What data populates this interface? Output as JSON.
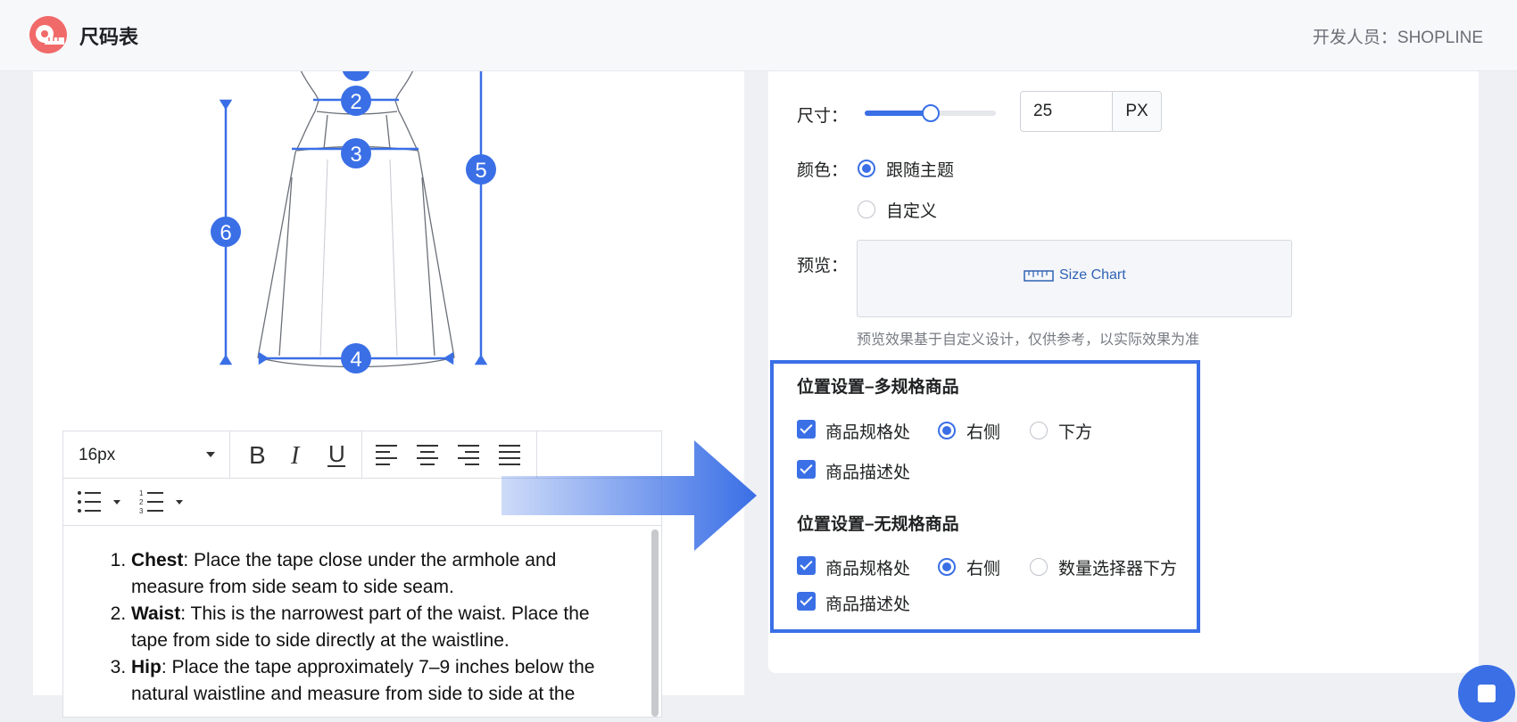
{
  "header": {
    "app_title": "尺码表",
    "developer": "开发人员：SHOPLINE"
  },
  "illustration": {
    "markers": [
      "2",
      "3",
      "4",
      "5",
      "6"
    ]
  },
  "editor": {
    "font_size": "16px",
    "items": [
      {
        "term": "Chest",
        "text": ": Place the tape close under the armhole and measure from side seam to side seam."
      },
      {
        "term": "Waist",
        "text": ": This is the narrowest part of the waist. Place the tape from side to side directly at the waistline."
      },
      {
        "term": "Hip",
        "text": ": Place the tape approximately 7–9 inches below the natural waistline and measure from side to side at the"
      }
    ]
  },
  "settings": {
    "size_label": "尺寸：",
    "size_value": "25",
    "size_unit": "PX",
    "size_fraction": 0.5,
    "color_label": "颜色：",
    "color_options": [
      {
        "label": "跟随主题",
        "selected": true
      },
      {
        "label": "自定义",
        "selected": false
      }
    ],
    "preview_label": "预览：",
    "preview_button": "Size Chart",
    "preview_hint": "预览效果基于自定义设计，仅供参考，以实际效果为准"
  },
  "position_multi": {
    "title": "位置设置–多规格商品",
    "spec_checkbox": "商品规格处",
    "right_radio": "右侧",
    "below_radio": "下方",
    "desc_checkbox": "商品描述处"
  },
  "position_single": {
    "title": "位置设置–无规格商品",
    "spec_checkbox": "商品规格处",
    "right_radio": "右侧",
    "below_radio": "数量选择器下方",
    "desc_checkbox": "商品描述处"
  },
  "colors": {
    "accent": "#3a6fe6",
    "logo": "#f16a6a"
  }
}
